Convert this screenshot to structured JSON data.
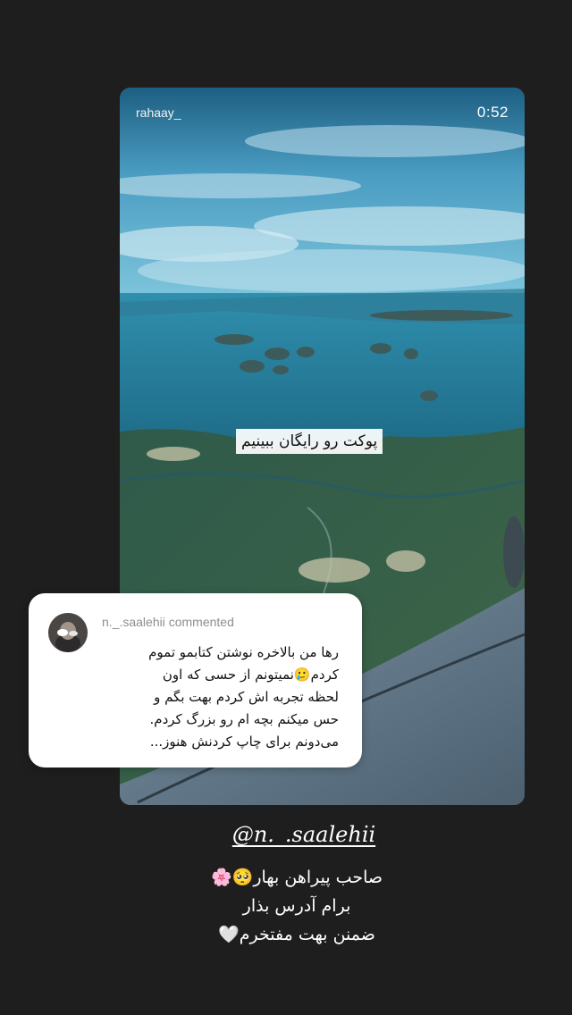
{
  "story": {
    "username": "rahaay_",
    "time": "0:52",
    "caption": "پوکت رو رایگان ببینیم"
  },
  "comment": {
    "author": "n._.saalehii",
    "action": "commented",
    "lines": [
      "رها من بالاخره نوشتن کتابمو تموم",
      "کردم🥲نمیتونم از حسی که اون",
      "لحظه تجربه اش کردم بهت بگم و",
      "حس میکنم بچه ام رو بزرگ کردم.",
      "می‌دونم برای چاپ کردنش هنوز..."
    ]
  },
  "mention": "@n._.saalehii",
  "reply": {
    "lines": [
      "صاحب پیراهن بهار🥺🌸",
      "برام آدرس بذار",
      "ضمنن بهت مفتخرم🤍"
    ]
  }
}
